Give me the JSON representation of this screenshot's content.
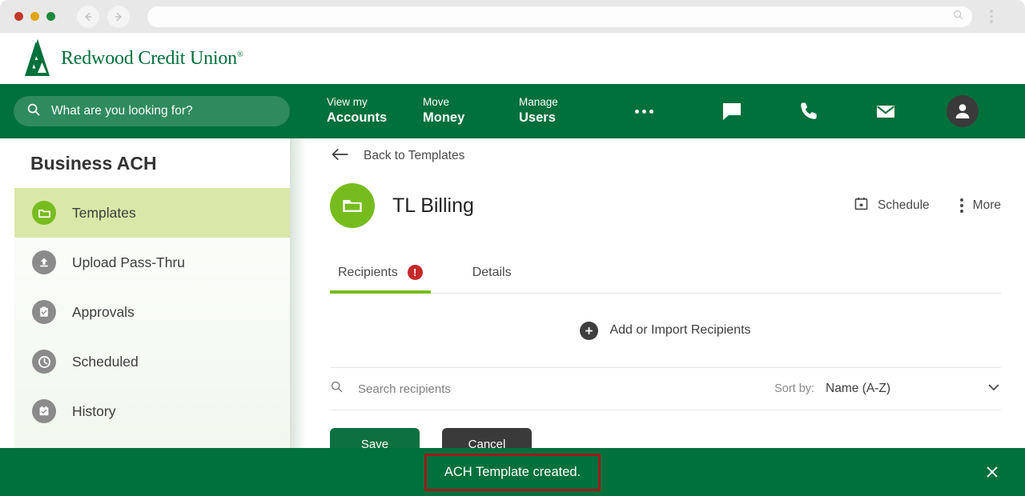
{
  "browser": {
    "traffic_lights": [
      "close",
      "minimize",
      "maximize"
    ],
    "back_icon": "arrow-left-icon",
    "forward_icon": "arrow-right-icon",
    "url_value": "",
    "url_search_icon": "search-icon",
    "menu_icon": "vertical-dots-icon"
  },
  "brand": {
    "name": "Redwood Credit Union",
    "registered_mark": "®",
    "logo_icon": "redwood-tree-logo",
    "color": "#00703c"
  },
  "topnav": {
    "background": "#00703c",
    "search": {
      "icon": "search-icon",
      "placeholder": "What are you looking for?",
      "value": ""
    },
    "items": [
      {
        "top": "View my",
        "bottom": "Accounts"
      },
      {
        "top": "Move",
        "bottom": "Money"
      },
      {
        "top": "Manage",
        "bottom": "Users"
      }
    ],
    "overflow_icon": "ellipsis-icon",
    "icons": [
      {
        "name": "chat-icon"
      },
      {
        "name": "phone-icon"
      },
      {
        "name": "mail-icon"
      }
    ],
    "avatar_icon": "user-avatar-icon"
  },
  "sidebar": {
    "title": "Business ACH",
    "active_color": "#d9e8a8",
    "items": [
      {
        "label": "Templates",
        "icon": "folder-icon",
        "active": true
      },
      {
        "label": "Upload Pass-Thru",
        "icon": "upload-icon",
        "active": false
      },
      {
        "label": "Approvals",
        "icon": "clipboard-check-icon",
        "active": false
      },
      {
        "label": "Scheduled",
        "icon": "clock-icon",
        "active": false
      },
      {
        "label": "History",
        "icon": "calendar-check-icon",
        "active": false
      }
    ]
  },
  "main": {
    "back_link": "Back to Templates",
    "back_icon": "arrow-left-icon",
    "template_title": "TL Billing",
    "template_icon": "folder-icon",
    "template_icon_color": "#77bc1f",
    "actions": [
      {
        "label": "Schedule",
        "icon": "calendar-icon"
      },
      {
        "label": "More",
        "icon": "vertical-dots-icon"
      }
    ],
    "tabs": [
      {
        "label": "Recipients",
        "active": true,
        "badge": "!"
      },
      {
        "label": "Details",
        "active": false,
        "badge": ""
      }
    ],
    "badge_color": "#c62828",
    "tab_underline_color": "#77bc1f",
    "add_recipients": {
      "label": "Add or Import Recipients",
      "icon": "plus-circle-icon"
    },
    "search": {
      "icon": "search-icon",
      "placeholder": "Search recipients",
      "value": ""
    },
    "sort": {
      "label": "Sort by:",
      "value": "Name (A-Z)",
      "chevron_icon": "chevron-down-icon"
    },
    "buttons": [
      {
        "label": "Save",
        "style": "primary"
      },
      {
        "label": "Cancel",
        "style": "secondary"
      }
    ]
  },
  "toast": {
    "message": "ACH Template created.",
    "background": "#00703c",
    "highlight_color": "#9b1c1c",
    "close_icon": "close-icon"
  }
}
